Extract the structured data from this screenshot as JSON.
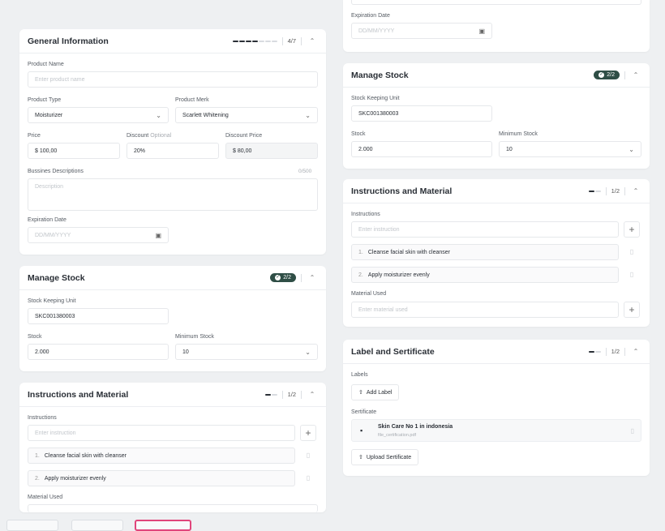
{
  "left": {
    "general": {
      "title": "General Information",
      "progress": "4/7",
      "product_name_label": "Product Name",
      "product_name_placeholder": "Enter product name",
      "product_type_label": "Product Type",
      "product_type_value": "Moisturizer",
      "product_merk_label": "Product Merk",
      "product_merk_value": "Scarlett Whitening",
      "price_label": "Price",
      "price_value": "$ 100,00",
      "discount_label": "Discount",
      "discount_optional": "Optional",
      "discount_value": "20%",
      "discount_price_label": "Discount Price",
      "discount_price_value": "$ 80,00",
      "desc_label": "Bussines Descriptions",
      "desc_counter": "0/500",
      "desc_placeholder": "Description",
      "exp_label": "Expiration Date",
      "exp_placeholder": "DD/MM/YYYY"
    },
    "stock": {
      "title": "Manage Stock",
      "badge": "2/2",
      "sku_label": "Stock Keeping Unit",
      "sku_value": "SKC001380003",
      "stock_label": "Stock",
      "stock_value": "2.000",
      "min_label": "Minimum Stock",
      "min_value": "10"
    },
    "instructions": {
      "title": "Instructions and Material",
      "progress": "1/2",
      "instr_label": "Instructions",
      "instr_placeholder": "Enter instruction",
      "items": [
        {
          "num": "1.",
          "text": "Cleanse facial skin with cleanser"
        },
        {
          "num": "2.",
          "text": "Apply moisturizer evenly"
        }
      ],
      "material_label": "Material Used"
    }
  },
  "right": {
    "top": {
      "exp_label": "Expiration Date",
      "exp_placeholder": "DD/MM/YYYY"
    },
    "stock": {
      "title": "Manage Stock",
      "badge": "2/2",
      "sku_label": "Stock Keeping Unit",
      "sku_value": "SKC001380003",
      "stock_label": "Stock",
      "stock_value": "2.000",
      "min_label": "Minimum Stock",
      "min_value": "10"
    },
    "instructions": {
      "title": "Instructions and Material",
      "progress": "1/2",
      "instr_label": "Instructions",
      "instr_placeholder": "Enter instruction",
      "items": [
        {
          "num": "1.",
          "text": "Cleanse facial skin with cleanser"
        },
        {
          "num": "2.",
          "text": "Apply moisturizer evenly"
        }
      ],
      "material_label": "Material Used",
      "material_placeholder": "Enter material used"
    },
    "label": {
      "title": "Label and Sertificate",
      "progress": "1/2",
      "labels_label": "Labels",
      "add_label": "Add Label",
      "cert_label": "Sertificate",
      "cert_name": "Skin Care No 1 in indonesia",
      "cert_file": "file_certification.pdf",
      "upload_label": "Upload Sertificate"
    }
  },
  "icons": {
    "calendar": "calendar-icon",
    "chevron_down": "chevron-down-icon",
    "chevron_up": "chevron-up-icon",
    "plus": "plus-icon",
    "trash": "trash-icon",
    "upload": "upload-icon",
    "file": "file-icon"
  },
  "colors": {
    "badge": "#2f4e46",
    "active_thumb": "#e0457b"
  }
}
